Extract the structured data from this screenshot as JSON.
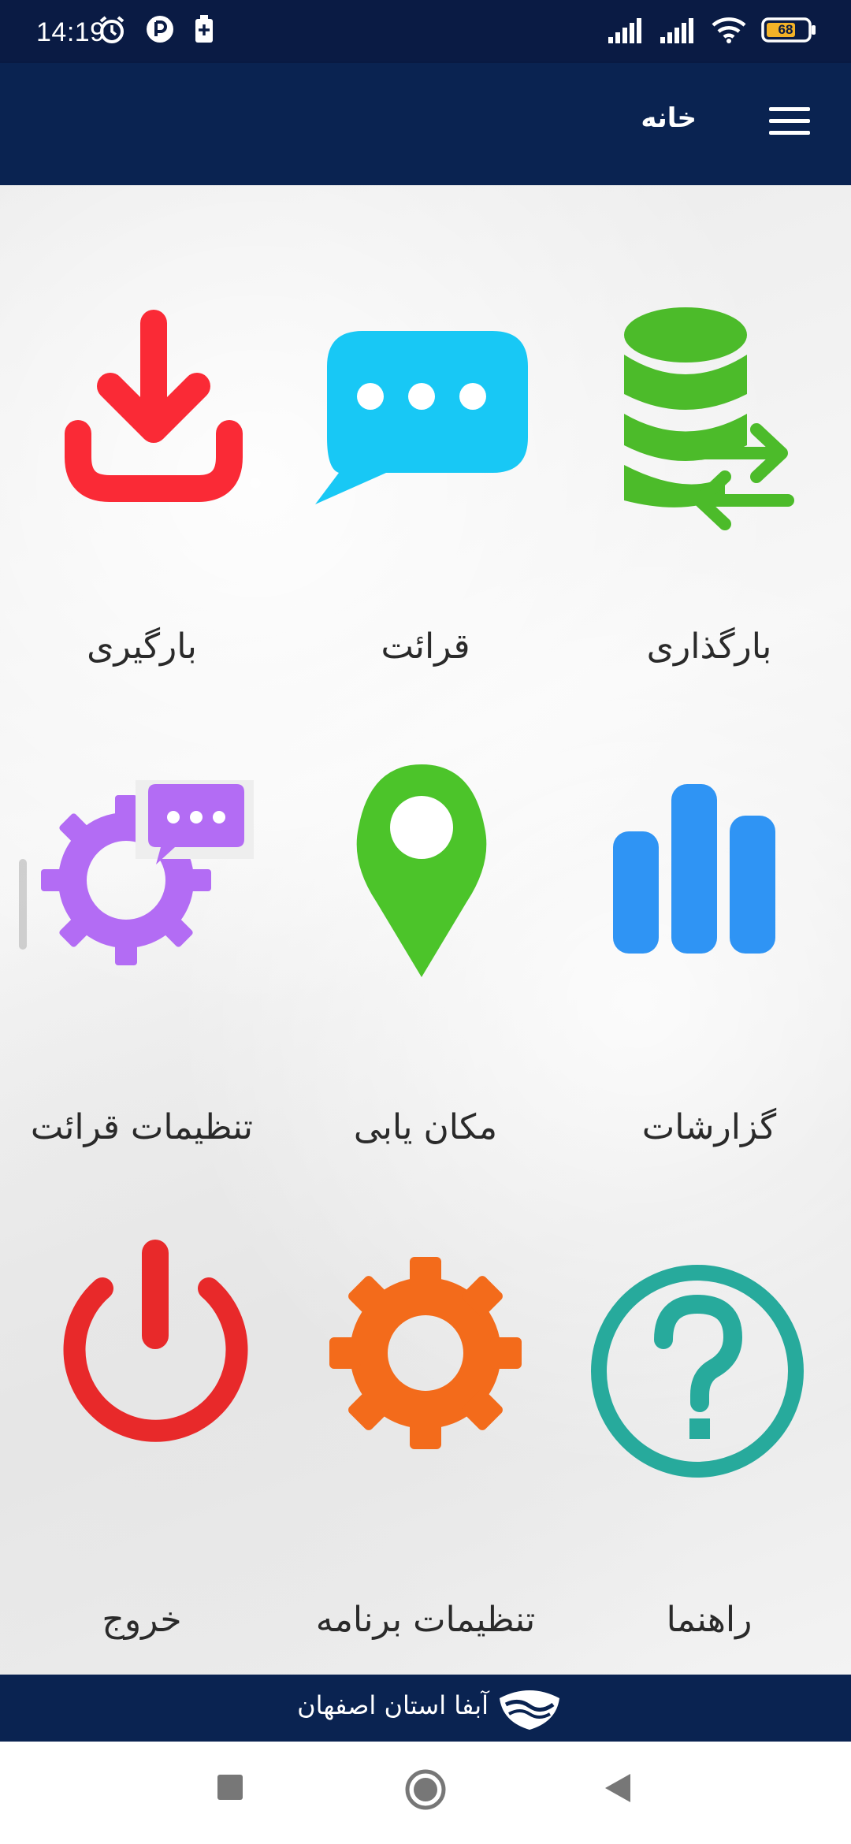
{
  "status_bar": {
    "time": "14:19",
    "battery_level": "68",
    "icons": [
      "alarm-icon",
      "app-notification-icon",
      "battery-saver-icon",
      "signal-icon",
      "signal-icon",
      "wifi-icon",
      "battery-icon"
    ]
  },
  "app_bar": {
    "title": "خانه",
    "menu_icon": "hamburger-menu-icon"
  },
  "tiles": [
    {
      "label": "بارگذاری",
      "icon": "database-sync-icon",
      "color": "#4cbb2a"
    },
    {
      "label": "قرائت",
      "icon": "chat-bubble-icon",
      "color": "#18c8f5"
    },
    {
      "label": "بارگیری",
      "icon": "download-icon",
      "color": "#fa2a36"
    },
    {
      "label": "گزارشات",
      "icon": "bar-chart-icon",
      "color": "#2f94f4"
    },
    {
      "label": "مکان یابی",
      "icon": "location-pin-icon",
      "color": "#4cc42a"
    },
    {
      "label": "تنظیمات قرائت",
      "icon": "gear-chat-icon",
      "color": "#b36cf4"
    },
    {
      "label": "راهنما",
      "icon": "help-icon",
      "color": "#27aa9c"
    },
    {
      "label": "تنظیمات برنامه",
      "icon": "gear-icon",
      "color": "#f36b1b"
    },
    {
      "label": "خروج",
      "icon": "power-icon",
      "color": "#e8292a"
    }
  ],
  "footer": {
    "text": "آبفا استان اصفهان",
    "logo_icon": "water-company-logo-icon"
  },
  "nav_bar": {
    "icons": [
      "recents-square-icon",
      "home-circle-icon",
      "back-triangle-icon"
    ]
  }
}
